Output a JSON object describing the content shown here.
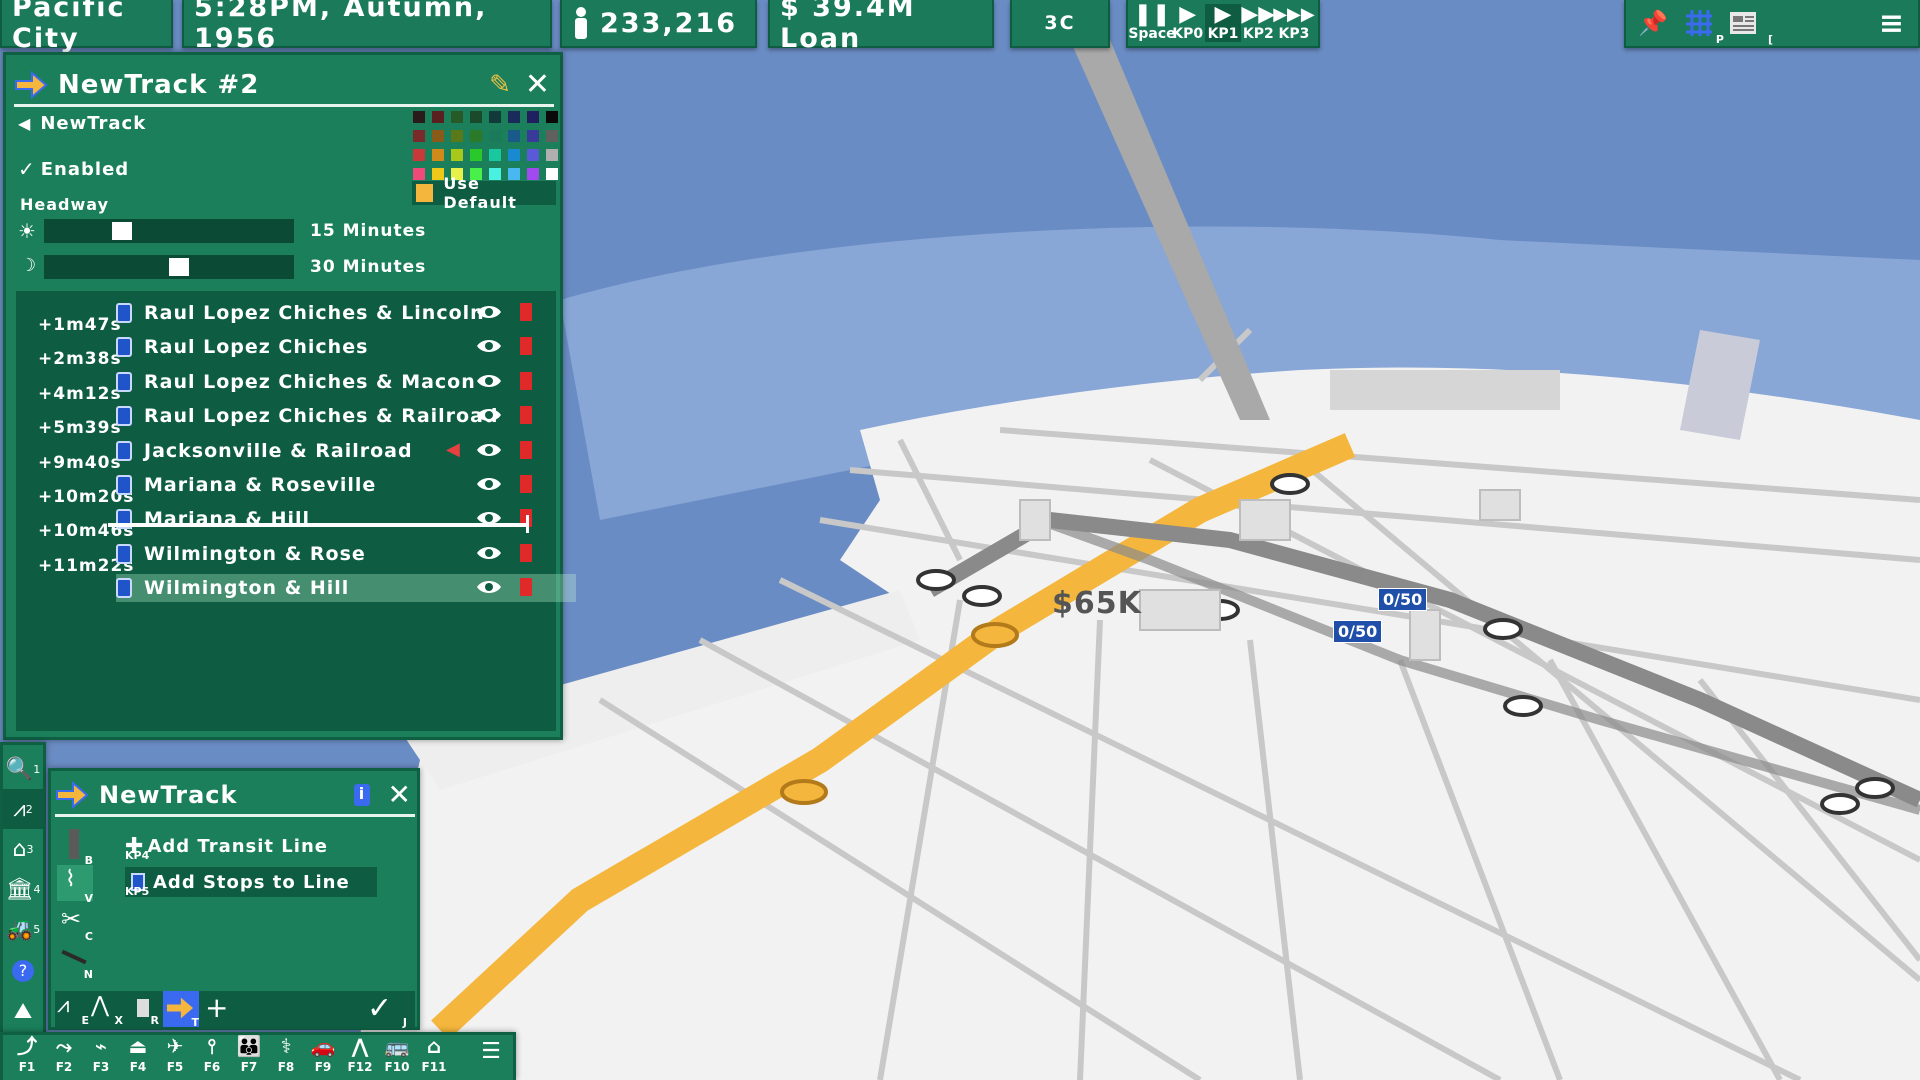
{
  "topbar": {
    "city": "Pacific City",
    "datetime": "5:28PM, Autumn, 1956",
    "population": "233,216",
    "money": "$ 39.4M Loan",
    "temperature": "3C",
    "speed": [
      {
        "label": "Space",
        "glyph": "❚❚"
      },
      {
        "label": "KP0",
        "glyph": "▶"
      },
      {
        "label": "KP1",
        "glyph": "▶"
      },
      {
        "label": "KP2",
        "glyph": "▶▶"
      },
      {
        "label": "KP3",
        "glyph": "▶▶▶"
      }
    ],
    "right_keys": [
      "P",
      "["
    ]
  },
  "line_panel": {
    "title": "NewTrack #2",
    "back_label": "NewTrack",
    "enabled_label": "Enabled",
    "headway_label": "Headway",
    "day_headway": "15 Minutes",
    "day_slider": 0.31,
    "night_headway": "30 Minutes",
    "night_slider": 0.54,
    "use_default_label": "Use Default",
    "times": [
      "+1m47s",
      "+2m38s",
      "+4m12s",
      "+5m39s",
      "+9m40s",
      "+10m20s",
      "+10m46s",
      "+11m22s"
    ],
    "stops": [
      "Raul Lopez Chiches & Lincoln",
      "Raul Lopez Chiches",
      "Raul Lopez Chiches & Macon",
      "Raul Lopez Chiches & Railroad",
      "Jacksonville & Railroad",
      "Mariana & Roseville",
      "Mariana & Hill",
      "Wilmington & Rose",
      "Wilmington & Hill"
    ],
    "palette": [
      "#2a1a1a",
      "#5a2020",
      "#285a28",
      "#1a4a2a",
      "#133a3a",
      "#1a2a5a",
      "#202060",
      "#0a0a0a",
      "#7a2a2a",
      "#8a5a1a",
      "#5a7a1a",
      "#2a7a2a",
      "#1a7a5a",
      "#1a5a8a",
      "#3a3a9a",
      "#606060",
      "#c83a3a",
      "#d08a1a",
      "#a8c81a",
      "#2ac82a",
      "#1ac8a0",
      "#1a8ad0",
      "#5a5ad8",
      "#b0b0b0",
      "#f04a7a",
      "#f0c81a",
      "#e8f04a",
      "#4af04a",
      "#4af0e0",
      "#4ab8f0",
      "#a04af0",
      "#ffffff"
    ]
  },
  "tool_panel": {
    "title": "NewTrack",
    "add_line": "Add Transit Line",
    "add_line_key": "KP4",
    "add_stops": "Add Stops to Line",
    "add_stops_key": "KP5",
    "side_keys": [
      "B",
      "V",
      "C",
      "N"
    ],
    "bottom_keys": [
      "E",
      "X",
      "R",
      "T",
      "J"
    ]
  },
  "left_tools": [
    "1",
    "2",
    "3",
    "4",
    "5"
  ],
  "fkeys": [
    "F1",
    "F2",
    "F3",
    "F4",
    "F5",
    "F6",
    "F7",
    "F8",
    "F9",
    "F12",
    "F10",
    "F11"
  ],
  "map": {
    "price_label": "$65K",
    "stop_count": "0",
    "capacity_badge_1": "0/50",
    "capacity_badge_2": "0/50"
  }
}
